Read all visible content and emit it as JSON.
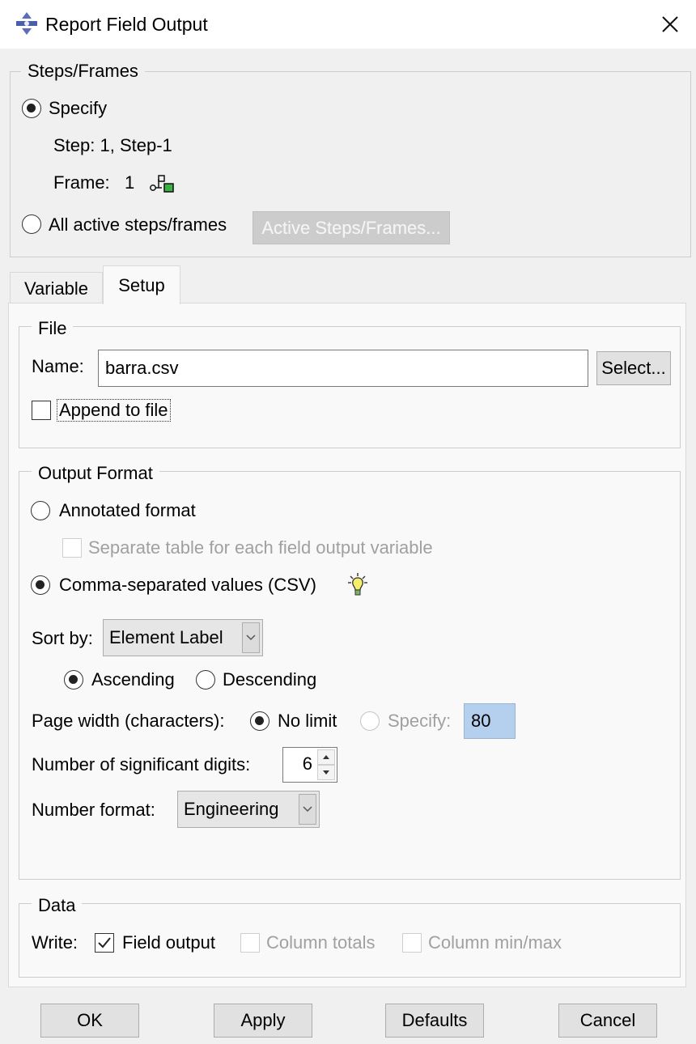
{
  "window": {
    "title": "Report Field Output",
    "icon": "abaqus-app-icon",
    "close_icon": "close-icon"
  },
  "steps_frames": {
    "group_label": "Steps/Frames",
    "specify_label": "Specify",
    "specify_selected": true,
    "step_text": "Step: 1, Step-1",
    "frame_label": "Frame:",
    "frame_value": "1",
    "frame_icon": "frame-select-icon",
    "all_active_label": "All active steps/frames",
    "all_active_selected": false,
    "active_button_label": "Active Steps/Frames..."
  },
  "tabs": [
    {
      "label": "Variable",
      "active": false
    },
    {
      "label": "Setup",
      "active": true
    }
  ],
  "file": {
    "group_label": "File",
    "name_label": "Name:",
    "name_value": "barra.csv",
    "select_button": "Select...",
    "append_label": "Append to file",
    "append_checked": false
  },
  "output_format": {
    "group_label": "Output Format",
    "annotated_label": "Annotated format",
    "annotated_selected": false,
    "separate_table_label": "Separate table for each field output variable",
    "separate_table_checked": false,
    "csv_label": "Comma-separated values (CSV)",
    "csv_selected": true,
    "hint_icon": "lightbulb-icon",
    "sort_by_label": "Sort by:",
    "sort_by_value": "Element Label",
    "ascending_label": "Ascending",
    "ascending_selected": true,
    "descending_label": "Descending",
    "descending_selected": false,
    "page_width_label": "Page width (characters):",
    "no_limit_label": "No limit",
    "no_limit_selected": true,
    "specify_width_label": "Specify:",
    "specify_width_selected": false,
    "specify_width_value": "80",
    "sig_digits_label": "Number of significant digits:",
    "sig_digits_value": "6",
    "number_format_label": "Number format:",
    "number_format_value": "Engineering"
  },
  "data": {
    "group_label": "Data",
    "write_label": "Write:",
    "field_output_label": "Field output",
    "field_output_checked": true,
    "column_totals_label": "Column totals",
    "column_totals_checked": false,
    "column_minmax_label": "Column min/max",
    "column_minmax_checked": false
  },
  "buttons": {
    "ok": "OK",
    "apply": "Apply",
    "defaults": "Defaults",
    "cancel": "Cancel"
  },
  "colors": {
    "window_bg": "#f0f0f0",
    "titlebar_bg": "#ffffff",
    "highlight_input_bg": "#b4d0ee"
  }
}
